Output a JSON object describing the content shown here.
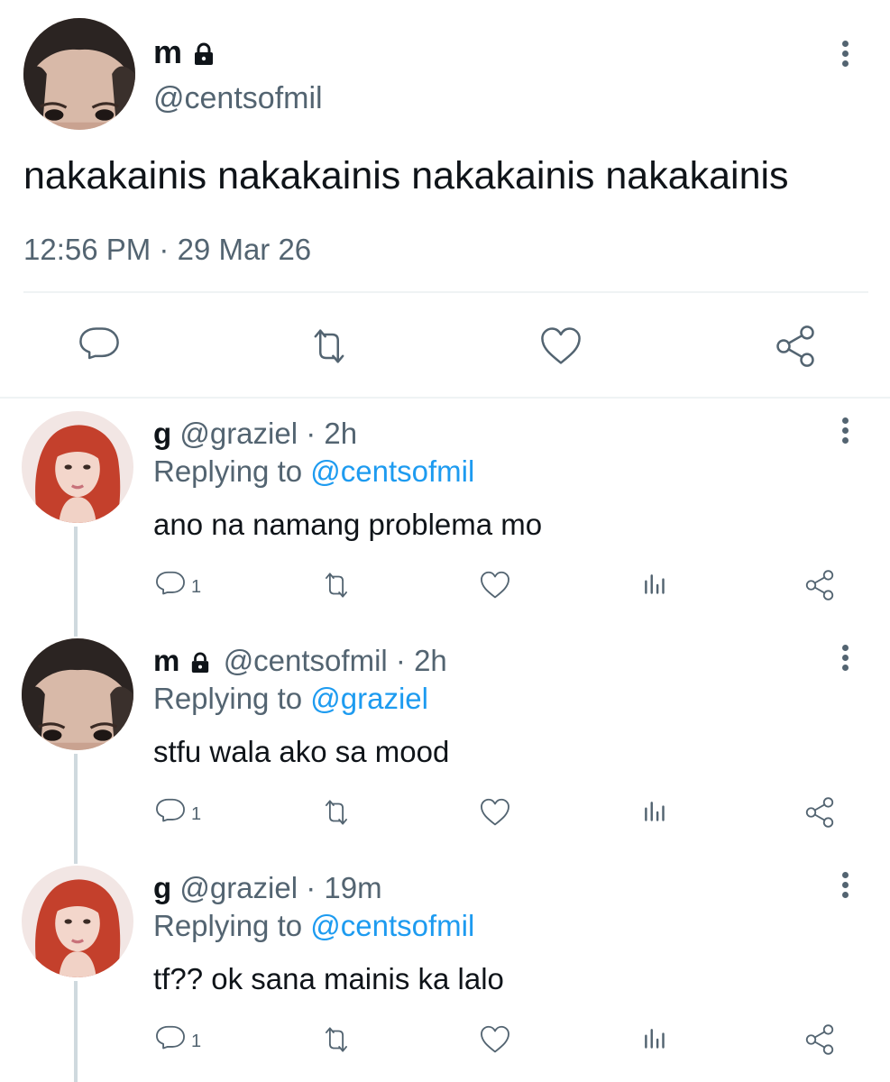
{
  "main_tweet": {
    "display_name": "m",
    "handle": "@centsofmil",
    "text": "nakakainis nakakainis nakakainis nakakainis",
    "timestamp": "12:56 PM · 29 Mar 26",
    "verified_lock": true
  },
  "action_bar": {
    "icons": [
      "reply-icon",
      "retweet-icon",
      "like-icon",
      "share-icon"
    ]
  },
  "replies": [
    {
      "display_name": "g",
      "handle": "@graziel",
      "time": "· 2h",
      "replying_prefix": "Replying to",
      "replying_to": "@centsofmil",
      "text": "ano na namang problema mo",
      "reply_count": "1",
      "avatar": "red-hair"
    },
    {
      "display_name": "m",
      "handle": "@centsofmil",
      "time": "· 2h",
      "replying_prefix": "Replying to",
      "replying_to": "@graziel",
      "text": "stfu wala ako sa mood",
      "reply_count": "1",
      "avatar": "dark-hair",
      "locked": true
    },
    {
      "display_name": "g",
      "handle": "@graziel",
      "time": "· 19m",
      "replying_prefix": "Replying to",
      "replying_to": "@centsofmil",
      "text": "tf?? ok sana mainis ka lalo",
      "reply_count": "1",
      "avatar": "red-hair"
    }
  ],
  "colors": {
    "text": "#0f1419",
    "secondary": "#536471",
    "link": "#1d9bf0",
    "divider": "#eff3f4",
    "thread_line": "#cfd9de"
  }
}
